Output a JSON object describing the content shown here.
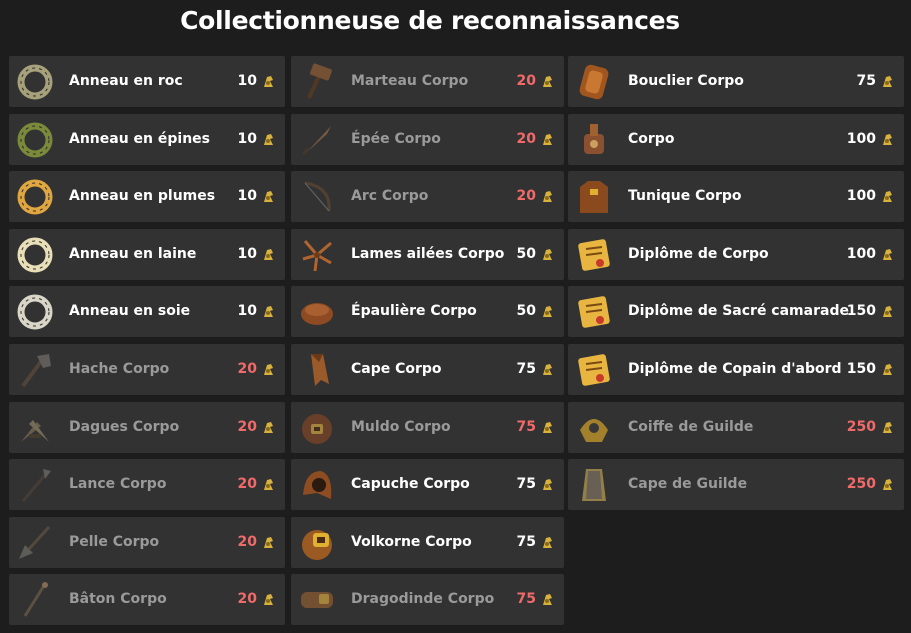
{
  "title": "Collectionneuse de reconnaissances",
  "colors": {
    "background": "#1d1d1d",
    "card": "#323232",
    "owned_text": "#ffffff",
    "locked_text": "#9a9a9a",
    "locked_price": "#f06a6a",
    "kama": "#d8b23e"
  },
  "columns": [
    {
      "items": [
        {
          "name": "Anneau en roc",
          "price": "10",
          "locked": false,
          "icon": "stone-ring-icon",
          "color": "#a6a17a"
        },
        {
          "name": "Anneau en épines",
          "price": "10",
          "locked": false,
          "icon": "thorn-ring-icon",
          "color": "#7b8a3a"
        },
        {
          "name": "Anneau en plumes",
          "price": "10",
          "locked": false,
          "icon": "feather-ring-icon",
          "color": "#e0a640"
        },
        {
          "name": "Anneau en laine",
          "price": "10",
          "locked": false,
          "icon": "wool-ring-icon",
          "color": "#e8dfb8"
        },
        {
          "name": "Anneau en soie",
          "price": "10",
          "locked": false,
          "icon": "silk-ring-icon",
          "color": "#d9d6c8"
        },
        {
          "name": "Hache Corpo",
          "price": "20",
          "locked": true,
          "icon": "axe-icon",
          "color": "#6e6a66"
        },
        {
          "name": "Dagues Corpo",
          "price": "20",
          "locked": true,
          "icon": "daggers-icon",
          "color": "#7a6c55"
        },
        {
          "name": "Lance Corpo",
          "price": "20",
          "locked": true,
          "icon": "spear-icon",
          "color": "#6e6a66"
        },
        {
          "name": "Pelle Corpo",
          "price": "20",
          "locked": true,
          "icon": "shovel-icon",
          "color": "#5f5140"
        },
        {
          "name": "Bâton Corpo",
          "price": "20",
          "locked": true,
          "icon": "staff-icon",
          "color": "#6a5a48"
        }
      ]
    },
    {
      "items": [
        {
          "name": "Marteau Corpo",
          "price": "20",
          "locked": true,
          "icon": "hammer-icon",
          "color": "#8a5b36"
        },
        {
          "name": "Épée Corpo",
          "price": "20",
          "locked": true,
          "icon": "sword-icon",
          "color": "#8a6a4a"
        },
        {
          "name": "Arc Corpo",
          "price": "20",
          "locked": true,
          "icon": "bow-icon",
          "color": "#5c4634"
        },
        {
          "name": "Lames ailées Corpo",
          "price": "50",
          "locked": false,
          "icon": "winged-blades-icon",
          "color": "#b0642f"
        },
        {
          "name": "Épaulière Corpo",
          "price": "50",
          "locked": false,
          "icon": "shoulder-pad-icon",
          "color": "#8e4a22"
        },
        {
          "name": "Cape Corpo",
          "price": "75",
          "locked": false,
          "icon": "cape-icon",
          "color": "#9a5a2a"
        },
        {
          "name": "Muldo Corpo",
          "price": "75",
          "locked": true,
          "icon": "muldo-icon",
          "color": "#7a4426"
        },
        {
          "name": "Capuche Corpo",
          "price": "75",
          "locked": false,
          "icon": "hood-icon",
          "color": "#8e4c22"
        },
        {
          "name": "Volkorne Corpo",
          "price": "75",
          "locked": false,
          "icon": "volkorne-icon",
          "color": "#9a5a22"
        },
        {
          "name": "Dragodinde Corpo",
          "price": "75",
          "locked": true,
          "icon": "dragoturkey-icon",
          "color": "#8a5a34"
        }
      ]
    },
    {
      "items": [
        {
          "name": "Bouclier Corpo",
          "price": "75",
          "locked": false,
          "icon": "shield-icon",
          "color": "#a0561e"
        },
        {
          "name": "Corpo",
          "price": "100",
          "locked": false,
          "icon": "corpo-pet-icon",
          "color": "#8a5030"
        },
        {
          "name": "Tunique Corpo",
          "price": "100",
          "locked": false,
          "icon": "tunic-icon",
          "color": "#8a4a1e"
        },
        {
          "name": "Diplôme de Corpo",
          "price": "100",
          "locked": false,
          "icon": "diploma-icon",
          "color": "#e8b640"
        },
        {
          "name": "Diplôme de Sacré camarade",
          "price": "150",
          "locked": false,
          "icon": "diploma-icon",
          "color": "#e8b640"
        },
        {
          "name": "Diplôme de Copain d'abord",
          "price": "150",
          "locked": false,
          "icon": "diploma-icon",
          "color": "#e8b640"
        },
        {
          "name": "Coiffe de Guilde",
          "price": "250",
          "locked": true,
          "icon": "guild-hat-icon",
          "color": "#c89a2a"
        },
        {
          "name": "Cape de Guilde",
          "price": "250",
          "locked": true,
          "icon": "guild-cape-icon",
          "color": "#b49a50"
        }
      ]
    }
  ]
}
